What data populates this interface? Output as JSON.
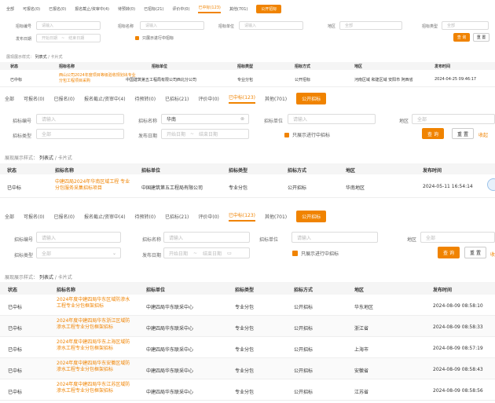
{
  "tabs": [
    "全部",
    "可报名(0)",
    "已报名(0)",
    "报名截止/资审中(4)",
    "待预转(0)",
    "已招标(21)",
    "评价中(0)",
    "已中标(123)",
    "其他(701)"
  ],
  "tab_active_index": 7,
  "publish_button": "公开招标",
  "labels": {
    "bid_no": "招标编号",
    "bid_name": "招标名称",
    "bid_unit": "招标单位",
    "region": "地区",
    "bid_type": "招标类型",
    "publish_date": "发布日期",
    "only_ongoing": "只展示进行中招标",
    "list_mode_prefix": "展现展示样式：",
    "mode_list": "列表式",
    "mode_card": "卡片式",
    "zoom_link": "收起"
  },
  "placeholders": {
    "input": "请输入",
    "region": "全部",
    "bid_type": "全部",
    "date_start": "开始日期",
    "date_end": "结束日期",
    "date_sep": "~"
  },
  "panel2_name_value": "华南",
  "buttons": {
    "search": "查 询",
    "reset": "重 置",
    "collapse": "收起"
  },
  "columns": [
    "状态",
    "招标名称",
    "招标单位",
    "招标类型",
    "招标方式",
    "地区",
    "发布时间"
  ],
  "panel1_row": {
    "status": "已中标",
    "name": "西山公司2024年度项目等级验收规划出专业分包工程项目采购",
    "unit": "中国建筑第五工程局有限公司西北分公司",
    "type": "专业分包",
    "method": "公开招标",
    "region": "河南区域 和建区域 安阳市 阿西省",
    "time": "2024-04-25 09:46:17"
  },
  "panel2_row": {
    "status": "已中标",
    "name": "中建四局2024年华南区域工程 专业分包服务采集招标项目",
    "unit": "中国建筑第五工程局有限公司",
    "type": "专业分包",
    "method": "公开招标",
    "region": "华南地区",
    "time": "2024-05-11 16:54:14"
  },
  "rows": [
    {
      "status": "已中标",
      "name": "2024年度中建四局华东区域防渗水工程专业分包框架招标",
      "unit": "中建四局华东联采中心",
      "type": "专业分包",
      "method": "公开招标",
      "region": "华东地区",
      "time": "2024-08-09 08:58:10"
    },
    {
      "status": "已中标",
      "name": "2024年度中建四局华东浙江区域防渗水工程专业分包框架招标",
      "unit": "中建四局华东联采中心",
      "type": "专业分包",
      "method": "公开招标",
      "region": "浙江省",
      "time": "2024-08-09 08:58:33"
    },
    {
      "status": "已中标",
      "name": "2024年度中建四局华东上海区域防渗水工程专业分包框架招标",
      "unit": "中建四局华东联采中心",
      "type": "专业分包",
      "method": "公开招标",
      "region": "上海市",
      "time": "2024-08-09 08:57:19"
    },
    {
      "status": "已中标",
      "name": "2024年度中建四局华东安徽区域防渗水工程专业分包框架招标",
      "unit": "中建四局华东联采中心",
      "type": "专业分包",
      "method": "公开招标",
      "region": "安徽省",
      "time": "2024-08-09 08:58:43"
    },
    {
      "status": "已中标",
      "name": "2024年度中建四局华东江苏区域防渗水工程专业分包框架招标",
      "unit": "中建四局华东联采中心",
      "type": "专业分包",
      "method": "公开招标",
      "region": "江苏省",
      "time": "2024-08-09 08:58:56"
    }
  ],
  "colors": {
    "accent": "#f08300"
  }
}
